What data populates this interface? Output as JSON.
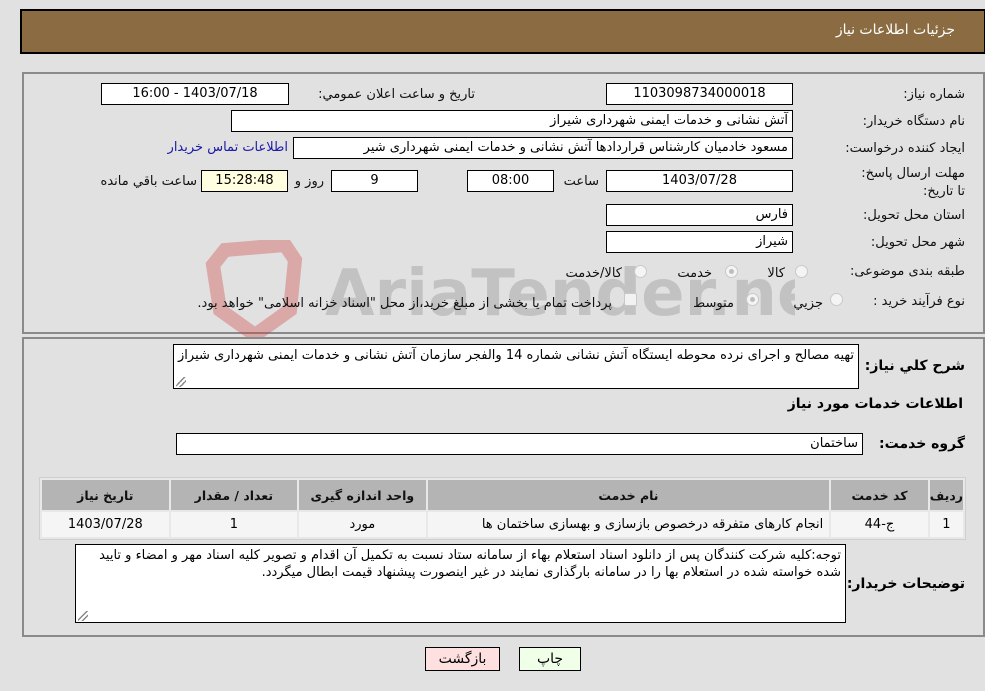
{
  "header": {
    "title": "جزئیات اطلاعات نیاز"
  },
  "form": {
    "need_number": {
      "label": "شماره نیاز:",
      "value": "1103098734000018"
    },
    "announce_datetime": {
      "label": "تاريخ و ساعت اعلان عمومي:",
      "value": "1403/07/18 - 16:00"
    },
    "buyer_org": {
      "label": "نام دستگاه خریدار:",
      "value": "آتش نشانی و خدمات ایمنی شهرداری شیراز"
    },
    "requester": {
      "label": "ایجاد کننده درخواست:",
      "value": "مسعود خادمیان کارشناس قراردادها آتش نشانی و خدمات ایمنی شهرداری شیر",
      "contact_link": "اطلاعات تماس خریدار"
    },
    "deadline": {
      "label": "مهلت ارسال پاسخ: تا تاریخ:",
      "date": "1403/07/28",
      "time_label": "ساعت",
      "time": "08:00",
      "days": "9",
      "days_label": "روز و",
      "remaining": "15:28:48",
      "remaining_label": "ساعت باقي مانده"
    },
    "province": {
      "label": "استان محل تحویل:",
      "value": "فارس"
    },
    "city": {
      "label": "شهر محل تحویل:",
      "value": "شیراز"
    },
    "category": {
      "label": "طبقه بندی موضوعی:",
      "options": [
        {
          "label": "کالا",
          "checked": false
        },
        {
          "label": "خدمت",
          "checked": true
        },
        {
          "label": "کالا/خدمت",
          "checked": false
        }
      ]
    },
    "purchase_type": {
      "label": "نوع فرآیند خرید :",
      "options": [
        {
          "label": "جزيي",
          "checked": false
        },
        {
          "label": "متوسط",
          "checked": true
        }
      ],
      "treasury_note": "پرداخت تمام یا بخشی از مبلغ خرید،از محل \"اسناد خزانه اسلامی\" خواهد بود."
    }
  },
  "description": {
    "label": "شرح کلي نياز:",
    "value": "تهیه مصالح و اجرای نرده محوطه ایستگاه آتش نشانی شماره 14 والفجر سازمان آتش نشانی و خدمات ایمنی شهرداری شیراز"
  },
  "services_section": {
    "title": "اطلاعات خدمات مورد نیاز",
    "group_label": "گروه خدمت:",
    "group_value": "ساختمان",
    "table": {
      "headers": [
        "ردیف",
        "کد خدمت",
        "نام خدمت",
        "واحد اندازه گیری",
        "تعداد / مقدار",
        "تاریخ نیاز"
      ],
      "rows": [
        [
          "1",
          "ج-44",
          "انجام کارهای متفرقه درخصوص بازسازی و بهسازی ساختمان ها",
          "مورد",
          "1",
          "1403/07/28"
        ]
      ]
    }
  },
  "buyer_notes": {
    "label": "توضیحات خریدار:",
    "value": "توجه:کلیه شرکت کنندگان پس از دانلود اسناد استعلام بهاء  از سامانه ستاد نسبت به تکمیل آن اقدام و تصویر کلیه اسناد مهر و امضاء و تایید شده خواسته شده در استعلام بها را در سامانه بارگذاری نمایند در غیر اینصورت پیشنهاد قیمت ابطال میگردد."
  },
  "buttons": {
    "print": "چاپ",
    "back": "بازگشت"
  },
  "watermark": {
    "text": "AriaTender.neT"
  }
}
